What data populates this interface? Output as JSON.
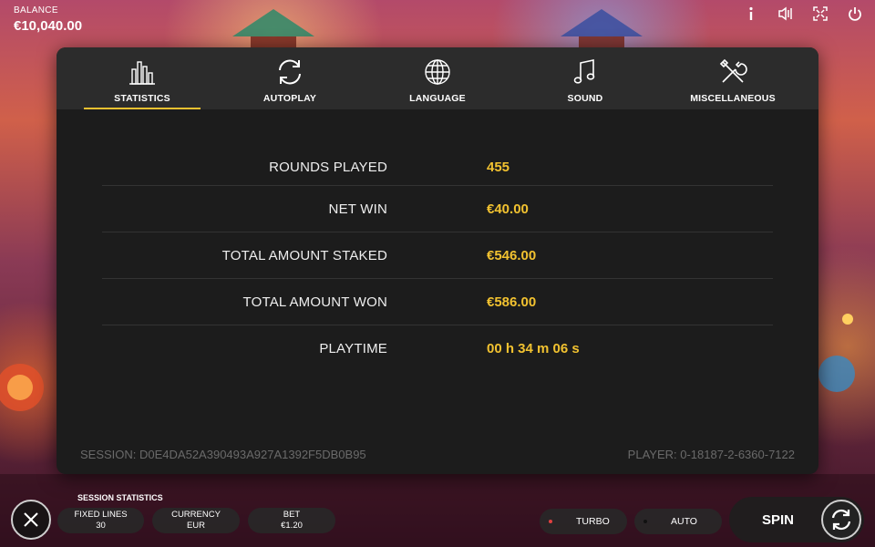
{
  "balance": {
    "label": "BALANCE",
    "value": "€10,040.00"
  },
  "top_icons": [
    "info-icon",
    "sound-icon",
    "fullscreen-icon",
    "power-icon"
  ],
  "tabs": [
    {
      "label": "STATISTICS",
      "icon": "bar-chart-icon",
      "active": true
    },
    {
      "label": "AUTOPLAY",
      "icon": "refresh-icon",
      "active": false
    },
    {
      "label": "LANGUAGE",
      "icon": "globe-icon",
      "active": false
    },
    {
      "label": "SOUND",
      "icon": "music-note-icon",
      "active": false
    },
    {
      "label": "MISCELLANEOUS",
      "icon": "tools-icon",
      "active": false
    }
  ],
  "stats": [
    {
      "label": "ROUNDS PLAYED",
      "value": "455"
    },
    {
      "label": "NET WIN",
      "value": "€40.00"
    },
    {
      "label": "TOTAL AMOUNT STAKED",
      "value": "€546.00"
    },
    {
      "label": "TOTAL AMOUNT WON",
      "value": "€586.00"
    },
    {
      "label": "PLAYTIME",
      "value": "00 h 34 m 06 s"
    }
  ],
  "session": "SESSION: D0E4DA52A390493A927A1392F5DB0B95",
  "player": "PLAYER: 0-18187-2-6360-7122",
  "bottom": {
    "session_stats_label": "SESSION STATISTICS",
    "fixed_lines": {
      "label": "FIXED LINES",
      "value": "30"
    },
    "currency": {
      "label": "CURRENCY",
      "value": "EUR"
    },
    "bet": {
      "label": "BET",
      "value": "€1.20"
    },
    "turbo": "TURBO",
    "auto": "AUTO",
    "spin": "SPIN"
  },
  "colors": {
    "accent": "#f2c230",
    "modal_bg": "#1c1c1c",
    "tab_bar_bg": "#2c2c2c"
  }
}
